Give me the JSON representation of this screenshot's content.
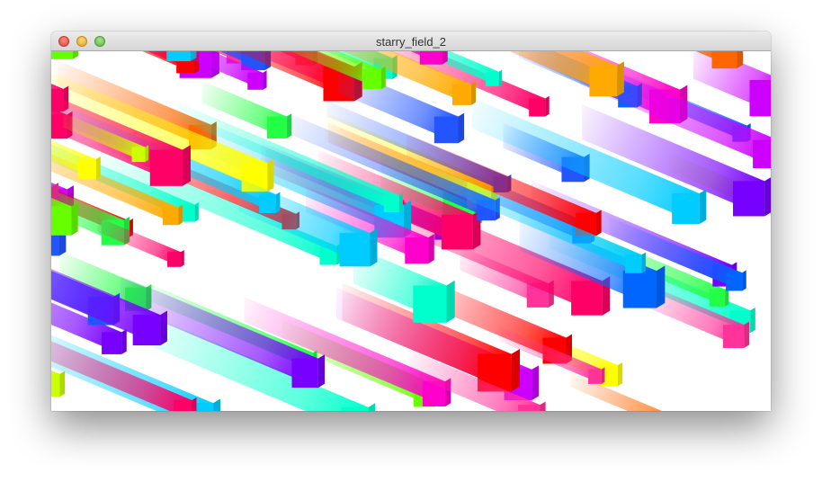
{
  "window": {
    "title": "starry_field_2"
  },
  "icons": {
    "close": "close-icon",
    "minimize": "minimize-icon",
    "zoom": "zoom-icon"
  },
  "palette": [
    "#ff00cc",
    "#ff3399",
    "#cc00ff",
    "#7700ff",
    "#2255ff",
    "#0066ff",
    "#00ccff",
    "#00ffcc",
    "#22ff44",
    "#66ff00",
    "#ccff00",
    "#ffff00",
    "#ffaa00",
    "#ff6600",
    "#ff0000",
    "#ff0066"
  ]
}
